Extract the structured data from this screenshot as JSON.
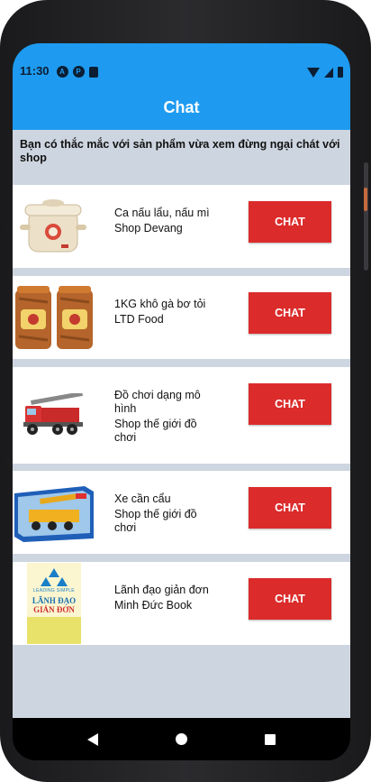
{
  "status_bar": {
    "time": "11:30",
    "left_icons": [
      "a-circle-icon",
      "p-circle-icon",
      "sd-card-icon"
    ],
    "right_icons": [
      "wifi-icon",
      "signal-icon",
      "battery-icon"
    ]
  },
  "app_bar": {
    "title": "Chat"
  },
  "notice": "Bạn có thắc mắc với sản phẩm vừa xem đừng ngại chát với shop",
  "items": [
    {
      "name": "Ca nấu lẩu, nấu mì",
      "shop": "Shop Devang",
      "button": "CHAT",
      "image": "electric-pot"
    },
    {
      "name": "1KG khô gà bơ tỏi",
      "shop": "LTD Food",
      "button": "CHAT",
      "image": "chicken-jars"
    },
    {
      "name": "Đồ chơi dạng mô hình",
      "shop": "Shop thế giới đồ chơi",
      "button": "CHAT",
      "image": "toy-fire-truck"
    },
    {
      "name": "Xe cần cẩu",
      "shop": "Shop thế giới đồ chơi",
      "button": "CHAT",
      "image": "crane-toy-box"
    },
    {
      "name": "Lãnh đạo giản đơn",
      "shop": "Minh Đức Book",
      "button": "CHAT",
      "image": "book-cover"
    }
  ],
  "book_cover": {
    "small_text": "LEADING SIMPLE",
    "title_line1": "LÃNH ĐẠO",
    "title_line2": "GIẢN ĐƠN"
  },
  "colors": {
    "primary": "#1e9bf0",
    "chat_button": "#dc2b2b",
    "background": "#cdd5e0"
  }
}
